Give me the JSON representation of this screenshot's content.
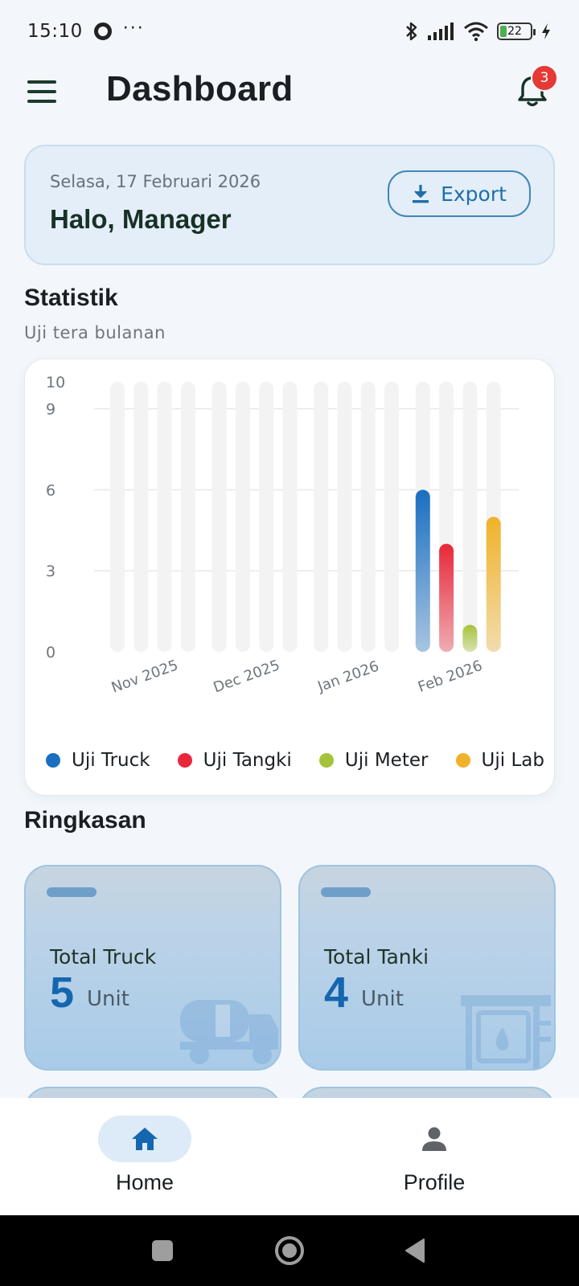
{
  "status_bar": {
    "time": "15:10",
    "dots": "···",
    "battery": "22"
  },
  "app_bar": {
    "title": "Dashboard",
    "notification_count": "3"
  },
  "greeting": {
    "date": "Selasa, 17 Februari 2026",
    "hello": "Halo, Manager",
    "export_label": "Export"
  },
  "statistik": {
    "title": "Statistik",
    "subtitle": "Uji tera bulanan"
  },
  "chart_data": {
    "type": "bar",
    "categories": [
      "Nov 2025",
      "Dec 2025",
      "Jan 2026",
      "Feb 2026"
    ],
    "series": [
      {
        "name": "Uji Truck",
        "color": "#1a6fc0",
        "values": [
          0,
          0,
          0,
          6
        ]
      },
      {
        "name": "Uji Tangki",
        "color": "#e8283a",
        "values": [
          0,
          0,
          0,
          4
        ]
      },
      {
        "name": "Uji Meter",
        "color": "#a6c23a",
        "values": [
          0,
          0,
          0,
          1
        ]
      },
      {
        "name": "Uji Lab",
        "color": "#f0b22a",
        "values": [
          0,
          0,
          0,
          5
        ]
      }
    ],
    "yticks": [
      "0",
      "3",
      "6",
      "9",
      "10"
    ],
    "ylim": [
      0,
      10
    ],
    "grid": true,
    "legend_position": "bottom"
  },
  "ringkasan": {
    "title": "Ringkasan",
    "cards": [
      {
        "label": "Total Truck",
        "value": "5",
        "unit": "Unit",
        "icon": "truck-icon"
      },
      {
        "label": "Total Tanki",
        "value": "4",
        "unit": "Unit",
        "icon": "tank-icon"
      }
    ]
  },
  "bottom_nav": {
    "items": [
      {
        "label": "Home",
        "icon": "home-icon",
        "active": true
      },
      {
        "label": "Profile",
        "icon": "person-icon",
        "active": false
      }
    ]
  },
  "colors": {
    "accent": "#1f6fa8",
    "badge": "#e53935"
  }
}
